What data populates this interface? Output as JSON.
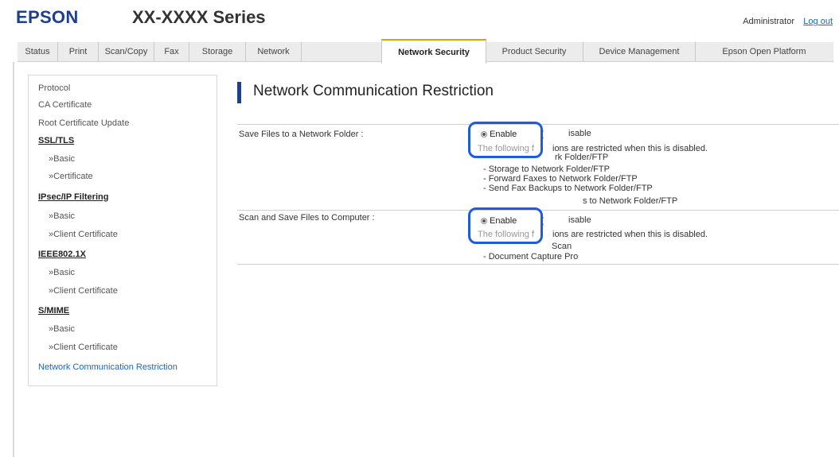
{
  "header": {
    "brand": "EPSON",
    "model": "XX-XXXX Series",
    "user": "Administrator",
    "logout": "Log out"
  },
  "tabs": [
    {
      "label": "Status"
    },
    {
      "label": "Print"
    },
    {
      "label": "Scan/Copy"
    },
    {
      "label": "Fax"
    },
    {
      "label": "Storage"
    },
    {
      "label": "Network"
    },
    {
      "label": "Network Security",
      "active": true
    },
    {
      "label": "Product Security"
    },
    {
      "label": "Device Management"
    },
    {
      "label": "Epson Open Platform"
    }
  ],
  "sidebar": {
    "protocol": "Protocol",
    "ca_certificate": "CA Certificate",
    "root_cert_update": "Root Certificate Update",
    "ssl_tls": "SSL/TLS",
    "ssl_basic": "»Basic",
    "ssl_certificate": "»Certificate",
    "ipsec": "IPsec/IP Filtering",
    "ipsec_basic": "»Basic",
    "ipsec_client_cert": "»Client Certificate",
    "ieee": "IEEE802.1X",
    "ieee_basic": "»Basic",
    "ieee_client_cert": "»Client Certificate",
    "smime": "S/MIME",
    "smime_basic": "»Basic",
    "smime_client_cert": "»Client Certificate",
    "ncr": "Network Communication Restriction"
  },
  "main": {
    "title": "Network Communication Restriction",
    "rows": [
      {
        "label": "Save Files to a Network Folder :",
        "enable": "Enable",
        "disable": "isable",
        "desc": [
          "The following f",
          "ions are restricted when this is disabled.",
          "rk Folder/FTP",
          "- Storage to Network Folder/FTP",
          "- Forward Faxes to Network Folder/FTP",
          "- Send Fax Backups to Network Folder/FTP",
          "s to Network Folder/FTP"
        ]
      },
      {
        "label": "Scan and Save Files to Computer :",
        "enable": "Enable",
        "disable": "isable",
        "desc": [
          "The following f",
          "ions are restricted when this is disabled.",
          "Scan",
          "- Document Capture Pro"
        ]
      }
    ]
  },
  "colors": {
    "brand": "#1f3f8c",
    "active_tab_accent": "#e0a010",
    "link": "#1a66c9",
    "highlight": "#1e5be0"
  }
}
